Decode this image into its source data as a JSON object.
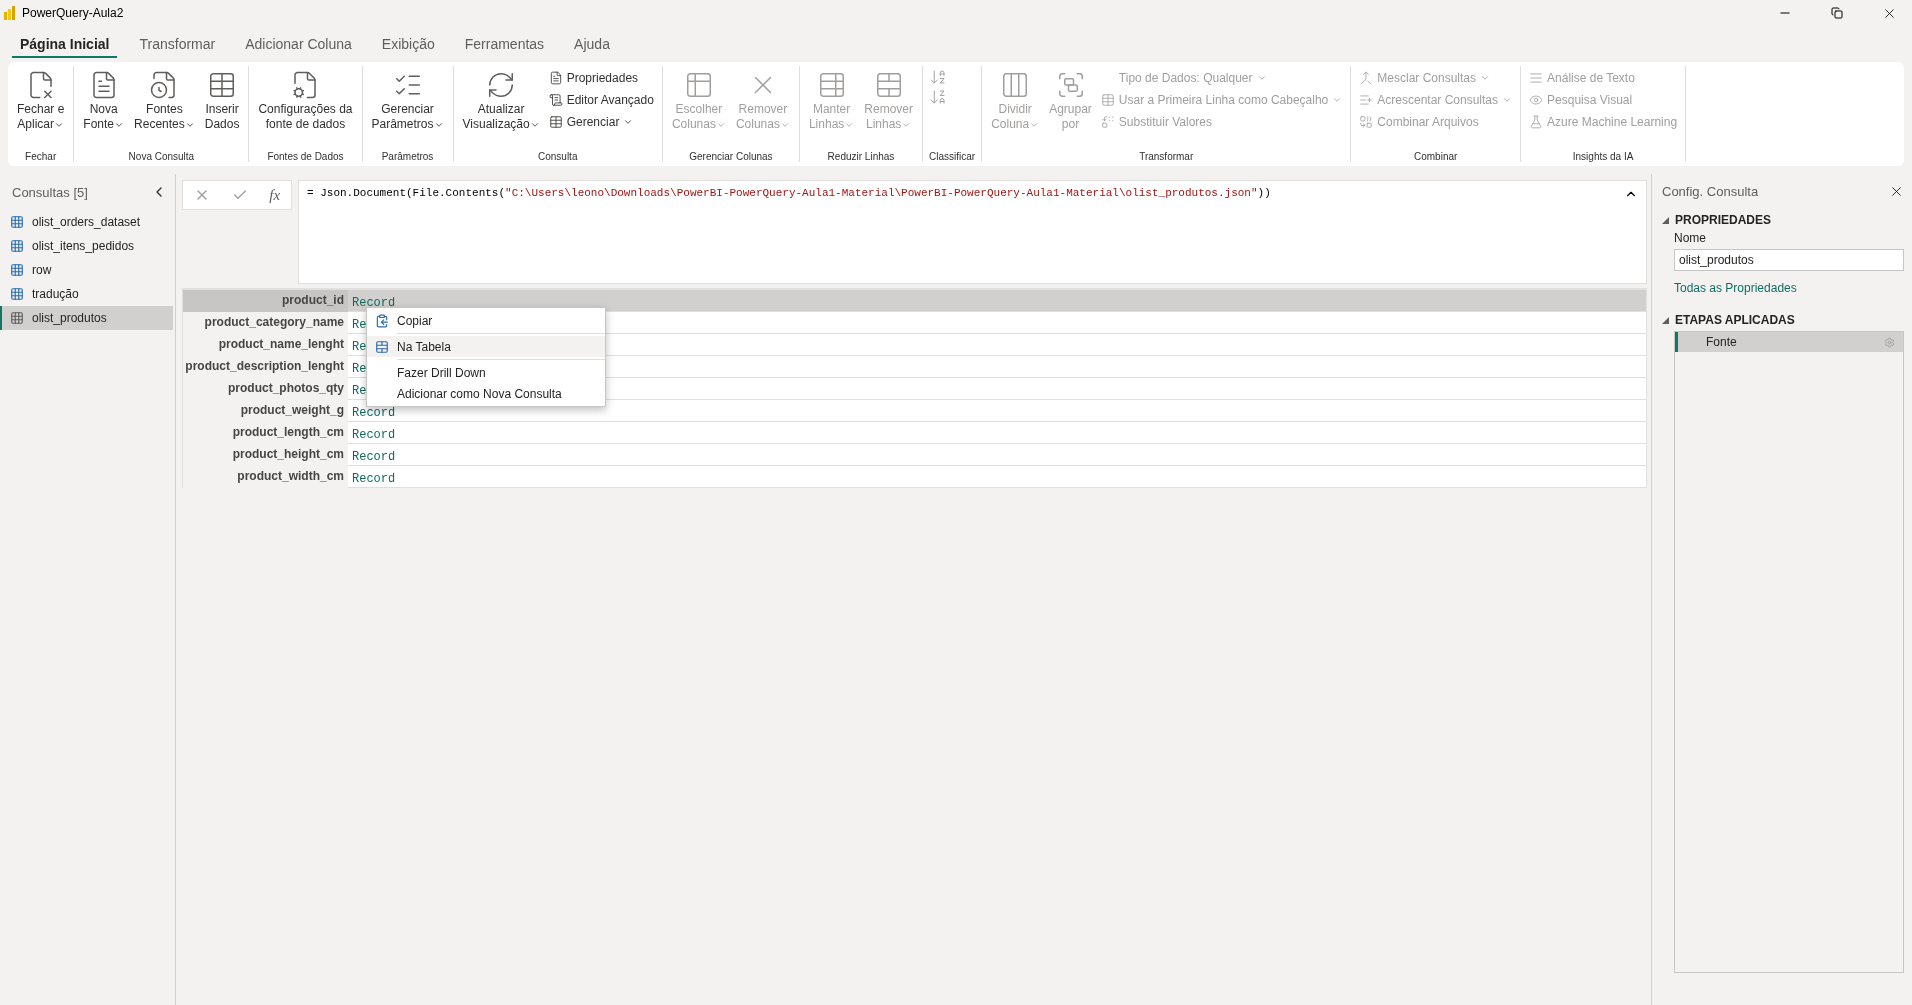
{
  "window": {
    "title": "PowerQuery-Aula2"
  },
  "tabs": [
    {
      "label": "Página Inicial",
      "selected": true
    },
    {
      "label": "Transformar",
      "selected": false
    },
    {
      "label": "Adicionar Coluna",
      "selected": false
    },
    {
      "label": "Exibição",
      "selected": false
    },
    {
      "label": "Ferramentas",
      "selected": false
    },
    {
      "label": "Ajuda",
      "selected": false
    }
  ],
  "ribbon_groups": [
    {
      "label": "Fechar",
      "items": [
        {
          "kind": "large",
          "lines": [
            "Fechar e",
            "Aplicar"
          ],
          "dropdown": true,
          "disabled": false
        }
      ]
    },
    {
      "label": "Nova Consulta",
      "items": [
        {
          "kind": "large",
          "lines": [
            "Nova",
            "Fonte"
          ],
          "dropdown": true,
          "disabled": false
        },
        {
          "kind": "large",
          "lines": [
            "Fontes",
            "Recentes"
          ],
          "dropdown": true,
          "disabled": false
        },
        {
          "kind": "large",
          "lines": [
            "Inserir",
            "Dados"
          ],
          "dropdown": false,
          "disabled": false
        }
      ]
    },
    {
      "label": "Fontes de Dados",
      "items": [
        {
          "kind": "large",
          "lines": [
            "Configurações da",
            "fonte de dados"
          ],
          "dropdown": false,
          "disabled": false
        }
      ]
    },
    {
      "label": "Parâmetros",
      "items": [
        {
          "kind": "large",
          "lines": [
            "Gerenciar",
            "Parâmetros"
          ],
          "dropdown": true,
          "disabled": false
        }
      ]
    },
    {
      "label": "Consulta",
      "items": [
        {
          "kind": "large",
          "lines": [
            "Atualizar",
            "Visualização"
          ],
          "dropdown": true,
          "disabled": false
        },
        {
          "kind": "stack",
          "entries": [
            {
              "label": "Propriedades",
              "dropdown": false,
              "disabled": false
            },
            {
              "label": "Editor Avançado",
              "dropdown": false,
              "disabled": false
            },
            {
              "label": "Gerenciar",
              "dropdown": true,
              "disabled": false
            }
          ]
        }
      ]
    },
    {
      "label": "Gerenciar Colunas",
      "items": [
        {
          "kind": "large",
          "lines": [
            "Escolher",
            "Colunas"
          ],
          "dropdown": true,
          "disabled": true
        },
        {
          "kind": "large",
          "lines": [
            "Remover",
            "Colunas"
          ],
          "dropdown": true,
          "disabled": true
        }
      ]
    },
    {
      "label": "Reduzir Linhas",
      "items": [
        {
          "kind": "large",
          "lines": [
            "Manter",
            "Linhas"
          ],
          "dropdown": true,
          "disabled": true
        },
        {
          "kind": "large",
          "lines": [
            "Remover",
            "Linhas"
          ],
          "dropdown": true,
          "disabled": true
        }
      ]
    },
    {
      "label": "Classificar",
      "items": [
        {
          "kind": "sort",
          "disabled": true
        }
      ]
    },
    {
      "label": "Transformar",
      "items": [
        {
          "kind": "large",
          "lines": [
            "Dividir",
            "Coluna"
          ],
          "dropdown": true,
          "disabled": true
        },
        {
          "kind": "large",
          "lines": [
            "Agrupar",
            "por"
          ],
          "dropdown": false,
          "disabled": true
        },
        {
          "kind": "stack",
          "entries": [
            {
              "label": "Tipo de Dados: Qualquer",
              "dropdown": true,
              "disabled": true
            },
            {
              "label": "Usar a Primeira Linha como Cabeçalho",
              "dropdown": true,
              "disabled": true
            },
            {
              "label": "Substituir Valores",
              "dropdown": false,
              "disabled": true
            }
          ]
        }
      ]
    },
    {
      "label": "Combinar",
      "items": [
        {
          "kind": "stack",
          "entries": [
            {
              "label": "Mesclar Consultas",
              "dropdown": true,
              "disabled": true
            },
            {
              "label": "Acrescentar Consultas",
              "dropdown": true,
              "disabled": true
            },
            {
              "label": "Combinar Arquivos",
              "dropdown": false,
              "disabled": true
            }
          ]
        }
      ]
    },
    {
      "label": "Insights da IA",
      "items": [
        {
          "kind": "stack",
          "entries": [
            {
              "label": "Análise de Texto",
              "dropdown": false,
              "disabled": true
            },
            {
              "label": "Pesquisa Visual",
              "dropdown": false,
              "disabled": true
            },
            {
              "label": "Azure Machine Learning",
              "dropdown": false,
              "disabled": true
            }
          ]
        }
      ]
    }
  ],
  "queries": {
    "title": "Consultas [5]",
    "items": [
      {
        "label": "olist_orders_dataset",
        "selected": false
      },
      {
        "label": "olist_itens_pedidos",
        "selected": false
      },
      {
        "label": "row",
        "selected": false
      },
      {
        "label": "tradução",
        "selected": false
      },
      {
        "label": "olist_produtos",
        "selected": true
      }
    ]
  },
  "formula_bar": {
    "fx_label": "fx",
    "prefix": "= Json.Document(File.Contents(",
    "path": "\"C:\\Users\\leono\\Downloads\\PowerBI-PowerQuery-Aula1-Material\\PowerBI-PowerQuery-Aula1-Material\\olist_produtos.json\"",
    "suffix": "))"
  },
  "table": {
    "rows": [
      {
        "label": "product_id",
        "value": "Record",
        "selected": true
      },
      {
        "label": "product_category_name",
        "value": "Re",
        "selected": false
      },
      {
        "label": "product_name_lenght",
        "value": "Re",
        "selected": false
      },
      {
        "label": "product_description_lenght",
        "value": "Re",
        "selected": false
      },
      {
        "label": "product_photos_qty",
        "value": "Re",
        "selected": false
      },
      {
        "label": "product_weight_g",
        "value": "Record",
        "selected": false
      },
      {
        "label": "product_length_cm",
        "value": "Record",
        "selected": false
      },
      {
        "label": "product_height_cm",
        "value": "Record",
        "selected": false
      },
      {
        "label": "product_width_cm",
        "value": "Record",
        "selected": false
      }
    ]
  },
  "context_menu": {
    "items": [
      {
        "label": "Copiar",
        "kind": "icon",
        "selected": false
      },
      {
        "label": "Na Tabela",
        "kind": "icon",
        "selected": true
      },
      {
        "label": "Fazer Drill Down",
        "kind": "plain",
        "selected": false
      },
      {
        "label": "Adicionar como Nova Consulta",
        "kind": "plain",
        "selected": false
      }
    ]
  },
  "query_settings": {
    "title": "Config. Consulta",
    "properties_heading": "PROPRIEDADES",
    "name_label": "Nome",
    "name_value": "olist_produtos",
    "all_properties_link": "Todas as Propriedades",
    "steps_heading": "ETAPAS APLICADAS",
    "steps": [
      {
        "label": "Fonte",
        "selected": true
      }
    ]
  }
}
